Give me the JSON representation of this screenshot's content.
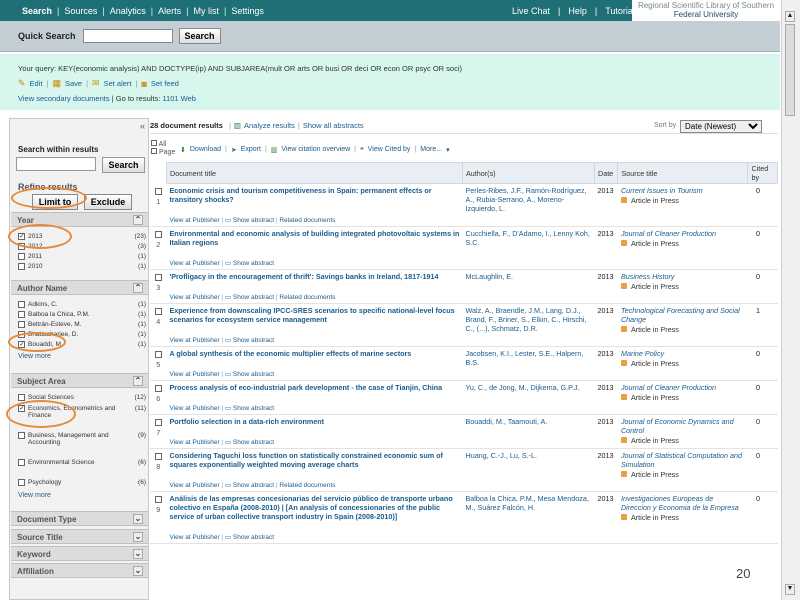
{
  "topbar": {
    "items": [
      "Search",
      "Sources",
      "Analytics",
      "Alerts",
      "My list",
      "Settings"
    ],
    "right": [
      "Live Chat",
      "Help",
      "Tutorials"
    ],
    "institution_line1": "Regional Scientific Library of Southern",
    "institution_line2": "Federal University"
  },
  "quick_search": {
    "label": "Quick Search",
    "value": "",
    "button": "Search"
  },
  "query": {
    "text": "Your query:  KEY(economic analysis) AND DOCTYPE(ip) AND SUBJAREA(mult OR arts OR busi OR deci OR econ OR psyc OR soci)",
    "edit": "Edit",
    "save": "Save",
    "set_alert": "Set alert",
    "set_feed": "Set feed",
    "view_secondary": "View secondary documents",
    "goto": "Go to results:",
    "goto_count": "1101",
    "web": "Web"
  },
  "sidebar": {
    "search_within_label": "Search within results",
    "search_button": "Search",
    "refine_title": "Refine results",
    "limit_button": "Limit to",
    "exclude_button": "Exclude",
    "view_more": "View more",
    "year": {
      "title": "Year",
      "items": [
        {
          "label": "2013",
          "count": "(23)",
          "checked": true
        },
        {
          "label": "2012",
          "count": "(3)",
          "checked": false
        },
        {
          "label": "2011",
          "count": "(1)",
          "checked": false
        },
        {
          "label": "2010",
          "count": "(1)",
          "checked": false
        }
      ]
    },
    "author": {
      "title": "Author Name",
      "items": [
        {
          "label": "Adkins, C.",
          "count": "(1)",
          "checked": false
        },
        {
          "label": "Balboa la Chica, P.M.",
          "count": "(1)",
          "checked": false
        },
        {
          "label": "Beltrán-Esteve, M.",
          "count": "(1)",
          "checked": false
        },
        {
          "label": "Bhattacharjee, D.",
          "count": "(1)",
          "checked": false
        },
        {
          "label": "Bouaddi, M.",
          "count": "(1)",
          "checked": true
        }
      ]
    },
    "subject": {
      "title": "Subject Area",
      "items": [
        {
          "label": "Social Sciences",
          "count": "(12)",
          "checked": false
        },
        {
          "label": "Economics, Econometrics and Finance",
          "count": "(11)",
          "checked": true
        },
        {
          "label": "Business, Management and Accounting",
          "count": "(9)",
          "checked": false
        },
        {
          "label": "Environmental Science",
          "count": "(6)",
          "checked": false
        },
        {
          "label": "Psychology",
          "count": "(6)",
          "checked": false
        }
      ]
    },
    "collapsed": [
      "Document Type",
      "Source Title",
      "Keyword",
      "Affiliation"
    ]
  },
  "results": {
    "count_text": "28 document results",
    "analyze": "Analyze results",
    "show_all": "Show all abstracts",
    "sort_label": "Sort by",
    "sort_value": "Date (Newest)",
    "all_label": "All",
    "page_label": "Page",
    "tools": [
      "Download",
      "Export",
      "View citation overview",
      "View Cited by",
      "More..."
    ],
    "headers": [
      "Document title",
      "Author(s)",
      "Date",
      "Source title",
      "Cited by"
    ],
    "view_at_publisher": "View at Publisher",
    "show_abstract": "Show abstract",
    "related": "Related documents",
    "article_in_press": "Article in Press",
    "rows": [
      {
        "n": "1",
        "title": "Economic crisis and tourism competitiveness in Spain: permanent effects or transitory shocks?",
        "authors": "Perles-Ribes, J.F., Ramón-Rodríguez, A., Rubia-Serrano, A., Moreno-Izquierdo, L.",
        "date": "2013",
        "source": "Current Issues in Tourism",
        "cited": "0",
        "related": true
      },
      {
        "n": "2",
        "title": "Environmental and economic analysis of building integrated photovoltaic systems in Italian regions",
        "authors": "Cucchiella, F., D'Adamo, I., Lenny Koh, S.C.",
        "date": "2013",
        "source": "Journal of Cleaner Production",
        "cited": "0",
        "related": false
      },
      {
        "n": "3",
        "title": "'Profligacy in the encouragement of thrift': Savings banks in Ireland, 1817-1914",
        "authors": "McLaughlin, E.",
        "date": "2013",
        "source": "Business History",
        "cited": "0",
        "related": true
      },
      {
        "n": "4",
        "title": "Experience from downscaling IPCC-SRES scenarios to specific national-level focus scenarios for ecosystem service management",
        "authors": "Walz, A., Braendle, J.M., Lang, D.J., Brand, F., Briner, S., Elkin, C., Hirschi, C., (...), Schmatz, D.R.",
        "date": "2013",
        "source": "Technological Forecasting and Social Change",
        "cited": "1",
        "related": false
      },
      {
        "n": "5",
        "title": "A global synthesis of the economic multiplier effects of marine sectors",
        "authors": "Jacobsen, K.I., Lester, S.E., Halpern, B.S.",
        "date": "2013",
        "source": "Marine Policy",
        "cited": "0",
        "related": false
      },
      {
        "n": "6",
        "title": "Process analysis of eco-industrial park development - the case of Tianjin, China",
        "authors": "Yu, C., de Jong, M., Dijkema, G.P.J.",
        "date": "2013",
        "source": "Journal of Cleaner Production",
        "cited": "0",
        "related": false
      },
      {
        "n": "7",
        "title": "Portfolio selection in a data-rich environment",
        "authors": "Bouaddi, M., Taamouti, A.",
        "date": "2013",
        "source": "Journal of Economic Dynamics and Control",
        "cited": "0",
        "related": false
      },
      {
        "n": "8",
        "title": "Considering Taguchi loss function on statistically constrained economic sum of squares exponentially weighted moving average charts",
        "authors": "Huang, C.-J., Lu, S.-L.",
        "date": "2013",
        "source": "Journal of Statistical Computation and Simulation",
        "cited": "0",
        "related": true
      },
      {
        "n": "9",
        "title": "Análisis de las empresas concesionarias del servicio público de transporte urbano colectivo en España (2008-2010) | [An analysis of concessionaries of the public service of urban collective transport industry in Spain (2008-2010)]",
        "authors": "Balboa la Chica, P.M., Mesa Mendoza, M., Suárez Falcón, H.",
        "date": "2013",
        "source": "Investigaciones Europeas de Direccion y Economia de la Empresa",
        "cited": "0",
        "related": false
      }
    ]
  },
  "slide_number": "20"
}
